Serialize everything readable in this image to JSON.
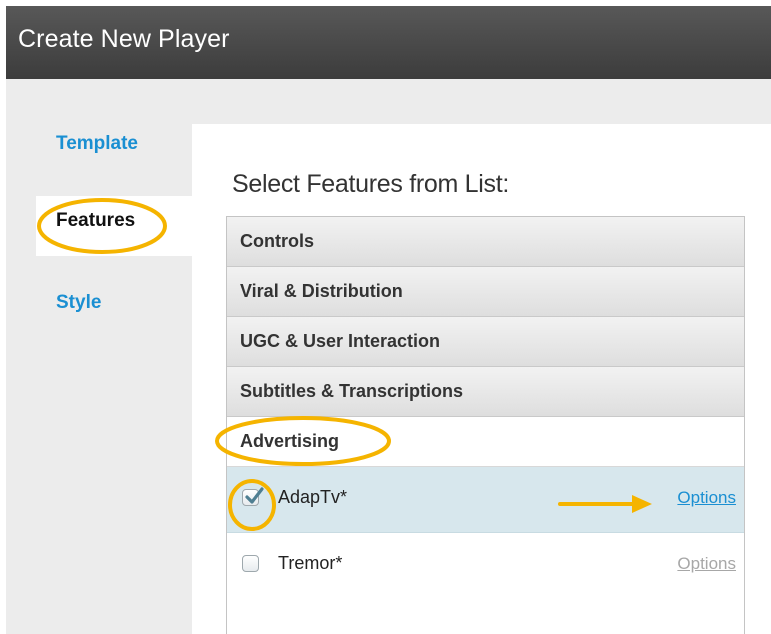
{
  "window": {
    "title": "Create New Player"
  },
  "sidebar": {
    "tabs": [
      {
        "label": "Template",
        "active": false
      },
      {
        "label": "Features",
        "active": true
      },
      {
        "label": "Style",
        "active": false
      }
    ]
  },
  "panel": {
    "heading": "Select Features from List:",
    "sections": [
      {
        "label": "Controls",
        "open": false
      },
      {
        "label": "Viral & Distribution",
        "open": false
      },
      {
        "label": "UGC & User Interaction",
        "open": false
      },
      {
        "label": "Subtitles & Transcriptions",
        "open": false
      },
      {
        "label": "Advertising",
        "open": true
      }
    ],
    "features": [
      {
        "name": "AdapTv*",
        "checked": true,
        "options_label": "Options",
        "options_enabled": true
      },
      {
        "name": "Tremor*",
        "checked": false,
        "options_label": "Options",
        "options_enabled": false
      }
    ]
  },
  "colors": {
    "titlebar": "#4a4a4a",
    "accent_blue": "#1a8fd2",
    "highlight_row": "#d7e7ed",
    "annotation": "#f5b400"
  },
  "icons": {
    "checkbox_checked": "check-icon",
    "annotation_arrow": "arrow-right-icon"
  }
}
